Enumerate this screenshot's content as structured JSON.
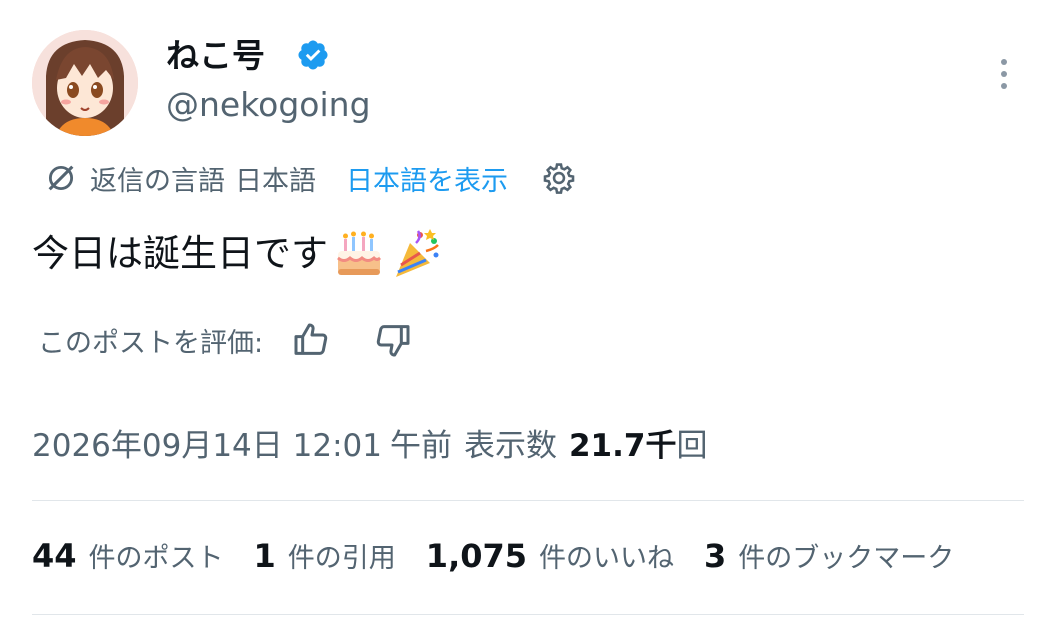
{
  "author": {
    "display_name": "ねこ号",
    "handle": "@nekogoing",
    "verified": true,
    "verified_color": "#1d9bf0"
  },
  "translation": {
    "icon": "translate-off-icon",
    "reply_language_label": "返信の言語",
    "language": "日本語",
    "show_link": "日本語を表示",
    "settings_icon": "gear-icon"
  },
  "post": {
    "text": "今日は誕生日です",
    "emojis": [
      "birthday-cake-emoji",
      "party-popper-emoji"
    ]
  },
  "rating": {
    "label": "このポストを評価:",
    "like_icon": "thumbs-up-icon",
    "dislike_icon": "thumbs-down-icon"
  },
  "meta": {
    "timestamp": "2026年09月14日 12:01",
    "ampm": "午前",
    "views_label": "表示数",
    "views_count": "21.7千",
    "views_suffix": "回"
  },
  "stats": [
    {
      "count": "44",
      "label": "件のポスト"
    },
    {
      "count": "1",
      "label": "件の引用"
    },
    {
      "count": "1,075",
      "label": "件のいいね"
    },
    {
      "count": "3",
      "label": "件のブックマーク"
    }
  ],
  "colors": {
    "text_primary": "#0f1419",
    "text_secondary": "#536471",
    "accent": "#1d9bf0",
    "divider": "#e1e6ea"
  }
}
